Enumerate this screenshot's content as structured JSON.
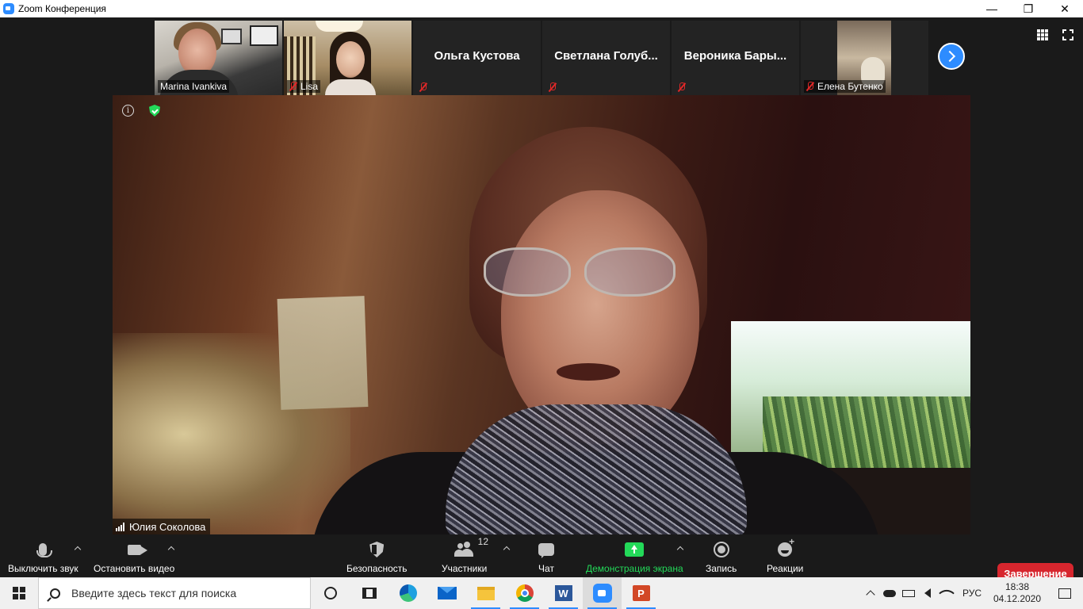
{
  "window": {
    "title": "Zoom Конференция",
    "minimize": "—",
    "restore": "❐",
    "close": "✕"
  },
  "participants": [
    {
      "name": "Marina Ivankiva",
      "video": true,
      "muted": false
    },
    {
      "name": "Lisa",
      "video": true,
      "muted": true
    },
    {
      "name": "Ольга Кустова",
      "video": false,
      "muted": true
    },
    {
      "name": "Светлана  Голуб...",
      "video": false,
      "muted": true
    },
    {
      "name": "Вероника  Бары...",
      "video": false,
      "muted": true
    },
    {
      "name": "Елена Бутенко",
      "video": true,
      "muted": true
    }
  ],
  "active_speaker": {
    "name": "Юлия Соколова",
    "info_icon": "i"
  },
  "toolbar": {
    "mute": "Выключить звук",
    "video": "Остановить видео",
    "security": "Безопасность",
    "participants": "Участники",
    "participants_count": "12",
    "chat": "Чат",
    "share": "Демонстрация экрана",
    "record": "Запись",
    "reactions": "Реакции",
    "end": "Завершение"
  },
  "taskbar": {
    "search_placeholder": "Введите здесь текст для поиска",
    "word_letter": "W",
    "ppt_letter": "P",
    "language": "РУС",
    "time": "18:38",
    "date": "04.12.2020"
  },
  "colors": {
    "zoom_blue": "#2d8cff",
    "share_green": "#23d959",
    "end_red": "#d7262e"
  }
}
